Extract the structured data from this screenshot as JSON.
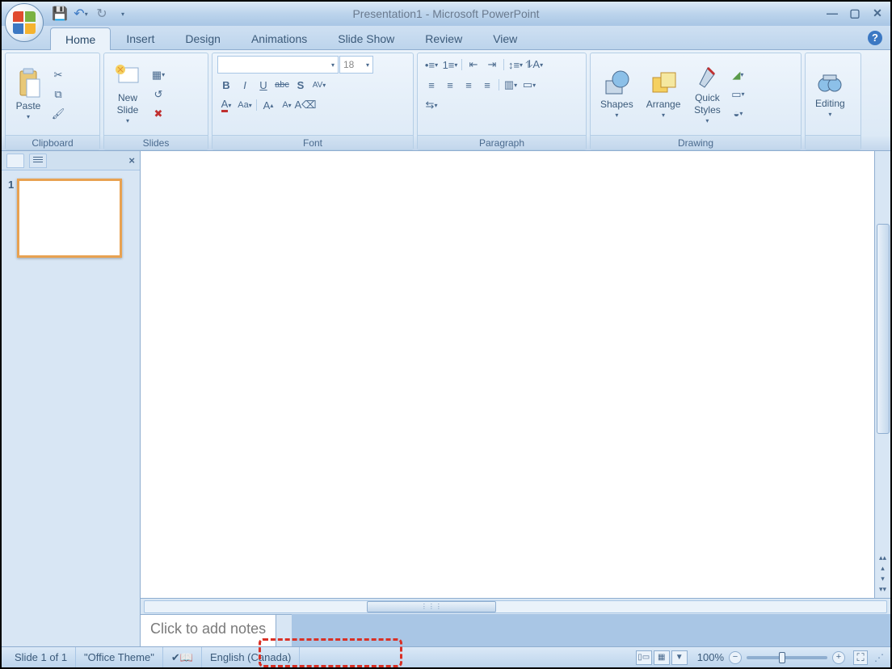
{
  "title": "Presentation1 - Microsoft PowerPoint",
  "qat": {
    "save": "💾",
    "undo": "↶",
    "redo": "↻"
  },
  "tabs": [
    "Home",
    "Insert",
    "Design",
    "Animations",
    "Slide Show",
    "Review",
    "View"
  ],
  "active_tab": "Home",
  "ribbon": {
    "clipboard": {
      "label": "Clipboard",
      "paste": "Paste",
      "cut": "✂",
      "copy": "⧉",
      "painter": "🖌"
    },
    "slides": {
      "label": "Slides",
      "new": "New\nSlide",
      "layout": "▦",
      "reset": "↺",
      "delete": "✖"
    },
    "font": {
      "label": "Font",
      "name_placeholder": "",
      "size": "18",
      "bold": "B",
      "italic": "I",
      "underline": "U",
      "strike": "abc",
      "shadow": "S",
      "spacing": "AV",
      "color": "A",
      "case": "Aa",
      "grow": "A↑",
      "shrink": "A↓",
      "clear": "⌫"
    },
    "paragraph": {
      "label": "Paragraph",
      "bullets": "≡",
      "numbering": "≡",
      "indent_dec": "⇤",
      "indent_inc": "⇥",
      "line_sp": "↕",
      "dir": "¶",
      "align_l": "≡",
      "align_c": "≡",
      "align_r": "≡",
      "align_j": "≡",
      "cols": "▥",
      "smart": "⇆"
    },
    "drawing": {
      "label": "Drawing",
      "shapes": "Shapes",
      "arrange": "Arrange",
      "quick": "Quick\nStyles",
      "fill": "◧",
      "outline": "▭",
      "effects": "✦"
    },
    "editing": {
      "label": "Editing",
      "find": "🔍"
    }
  },
  "side": {
    "thumb_num": "1"
  },
  "notes_placeholder": "Click to add notes",
  "status": {
    "slide": "Slide 1 of 1",
    "theme": "\"Office Theme\"",
    "lang": "English (Canada)",
    "zoom": "100%"
  }
}
